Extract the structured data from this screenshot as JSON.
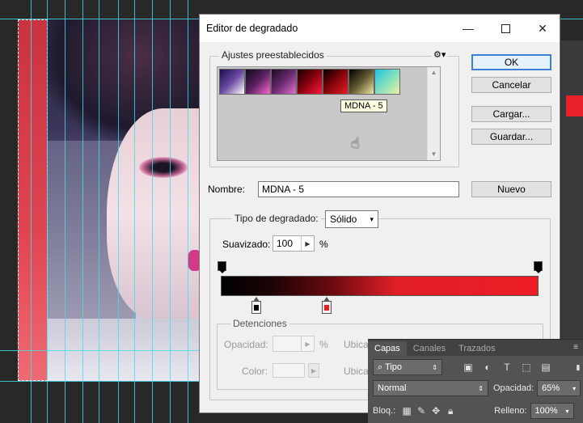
{
  "dialog": {
    "title": "Editor de degradado",
    "presets_label": "Ajustes preestablecidos",
    "presets": [
      {
        "name": "gradient-1",
        "from": "#1a0d50",
        "to": "#ffffff"
      },
      {
        "name": "gradient-2",
        "from": "#0d0a1a",
        "to": "#ff66cc"
      },
      {
        "name": "gradient-3",
        "from": "#1a0a20",
        "to": "#e070d0"
      },
      {
        "name": "gradient-4",
        "from": "#1a0000",
        "to": "#ff1a3a"
      },
      {
        "name": "gradient-5",
        "from": "#000000",
        "to": "#ec1c24"
      },
      {
        "name": "gradient-6",
        "from": "#000000",
        "to": "#f0e8a0"
      },
      {
        "name": "gradient-7",
        "from": "#20c0e0",
        "to": "#f0f0a0"
      }
    ],
    "tooltip": "MDNA - 5",
    "buttons": {
      "ok": "OK",
      "cancel": "Cancelar",
      "load": "Cargar...",
      "save": "Guardar...",
      "new": "Nuevo"
    },
    "name_label": "Nombre:",
    "name_value": "MDNA - 5",
    "gradient_type_label": "Tipo de degradado:",
    "gradient_type_value": "Sólido",
    "smoothness_label": "Suavizado:",
    "smoothness_value": "100",
    "smoothness_unit": "%",
    "stops_label": "Detenciones",
    "opacity_label": "Opacidad:",
    "opacity_unit": "%",
    "location_label": "Ubica",
    "color_label": "Color:",
    "location_label_2": "Ubica",
    "stop_colors": {
      "left": "#000000",
      "right": "#ec1c24"
    }
  },
  "layers_panel": {
    "tabs": [
      "Capas",
      "Canales",
      "Trazados"
    ],
    "filter_value": "Tipo",
    "blend_mode": "Normal",
    "opacity_label": "Opacidad:",
    "opacity_value": "65%",
    "lock_label": "Bloq.:",
    "fill_label": "Relleno:",
    "fill_value": "100%"
  }
}
